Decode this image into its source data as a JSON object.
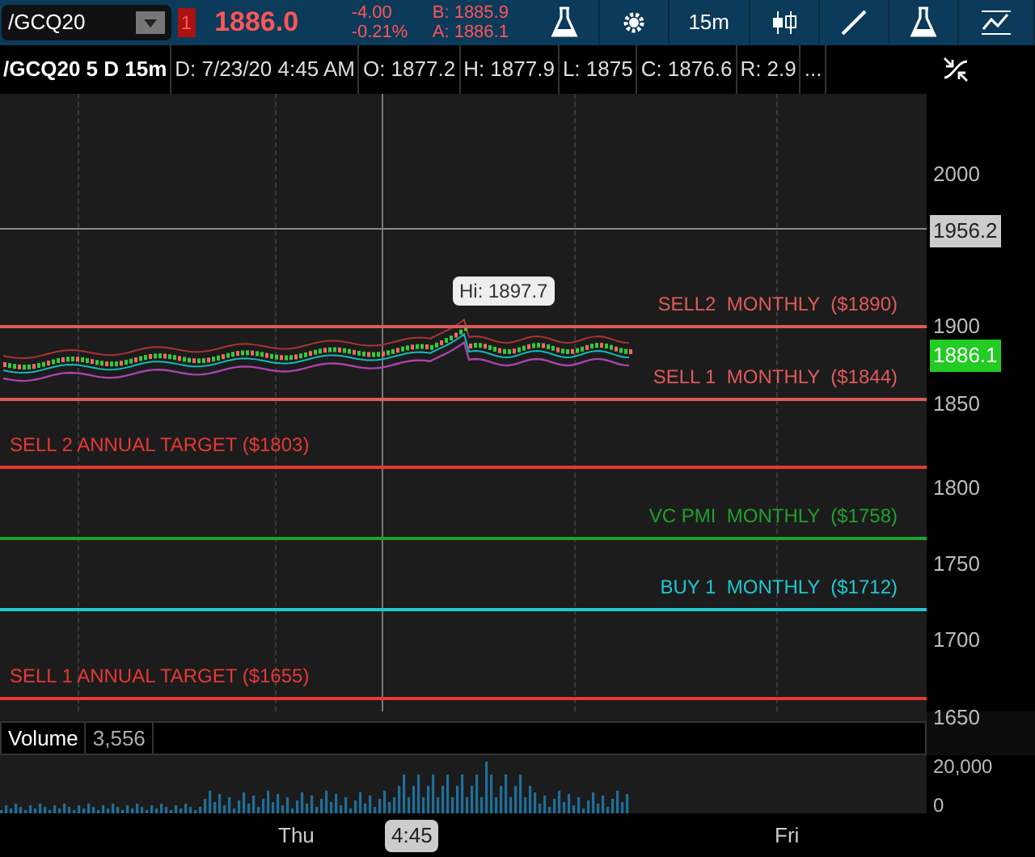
{
  "toolbar": {
    "symbol": "/GCQ20",
    "badge": "1",
    "price": "1886.0",
    "change": "-4.00",
    "change_pct": "-0.21%",
    "bid": "B: 1885.9",
    "ask": "A: 1886.1",
    "interval": "15m"
  },
  "info_bar": [
    "/GCQ20 5 D 15m",
    "D: 7/23/20 4:45 AM",
    "O: 1877.2",
    "H: 1877.9",
    "L: 1875",
    "C: 1876.6",
    "R: 2.9",
    "..."
  ],
  "price_axis": [
    "2000",
    "1900",
    "1850",
    "1800",
    "1750",
    "1700",
    "1650"
  ],
  "last_close_marker": "1956.2",
  "current_price": "1886.1",
  "high_bubble": "Hi: 1897.7",
  "levels": [
    {
      "label": "SELL2  MONTHLY  ($1890)",
      "color": "#e05a5a",
      "kind": "monthly"
    },
    {
      "label": "SELL 1  MONTHLY  ($1844)",
      "color": "#e05a5a",
      "kind": "monthly"
    },
    {
      "label": "SELL 2 ANNUAL TARGET ($1803)",
      "color": "#e53935",
      "kind": "annual"
    },
    {
      "label": "VC PMI  MONTHLY  ($1758)",
      "color": "#1fa12a",
      "kind": "monthly"
    },
    {
      "label": "BUY 1  MONTHLY  ($1712)",
      "color": "#1ec8d0",
      "kind": "monthly"
    },
    {
      "label": "SELL 1 ANNUAL TARGET ($1655)",
      "color": "#e53935",
      "kind": "annual"
    }
  ],
  "volume": {
    "title": "Volume",
    "value": "3,556",
    "axis": [
      "20,000",
      "0"
    ]
  },
  "time_axis": [
    {
      "label": "Thu",
      "selected": false
    },
    {
      "label": "4:45",
      "selected": true
    },
    {
      "label": "Fri",
      "selected": false
    }
  ]
}
